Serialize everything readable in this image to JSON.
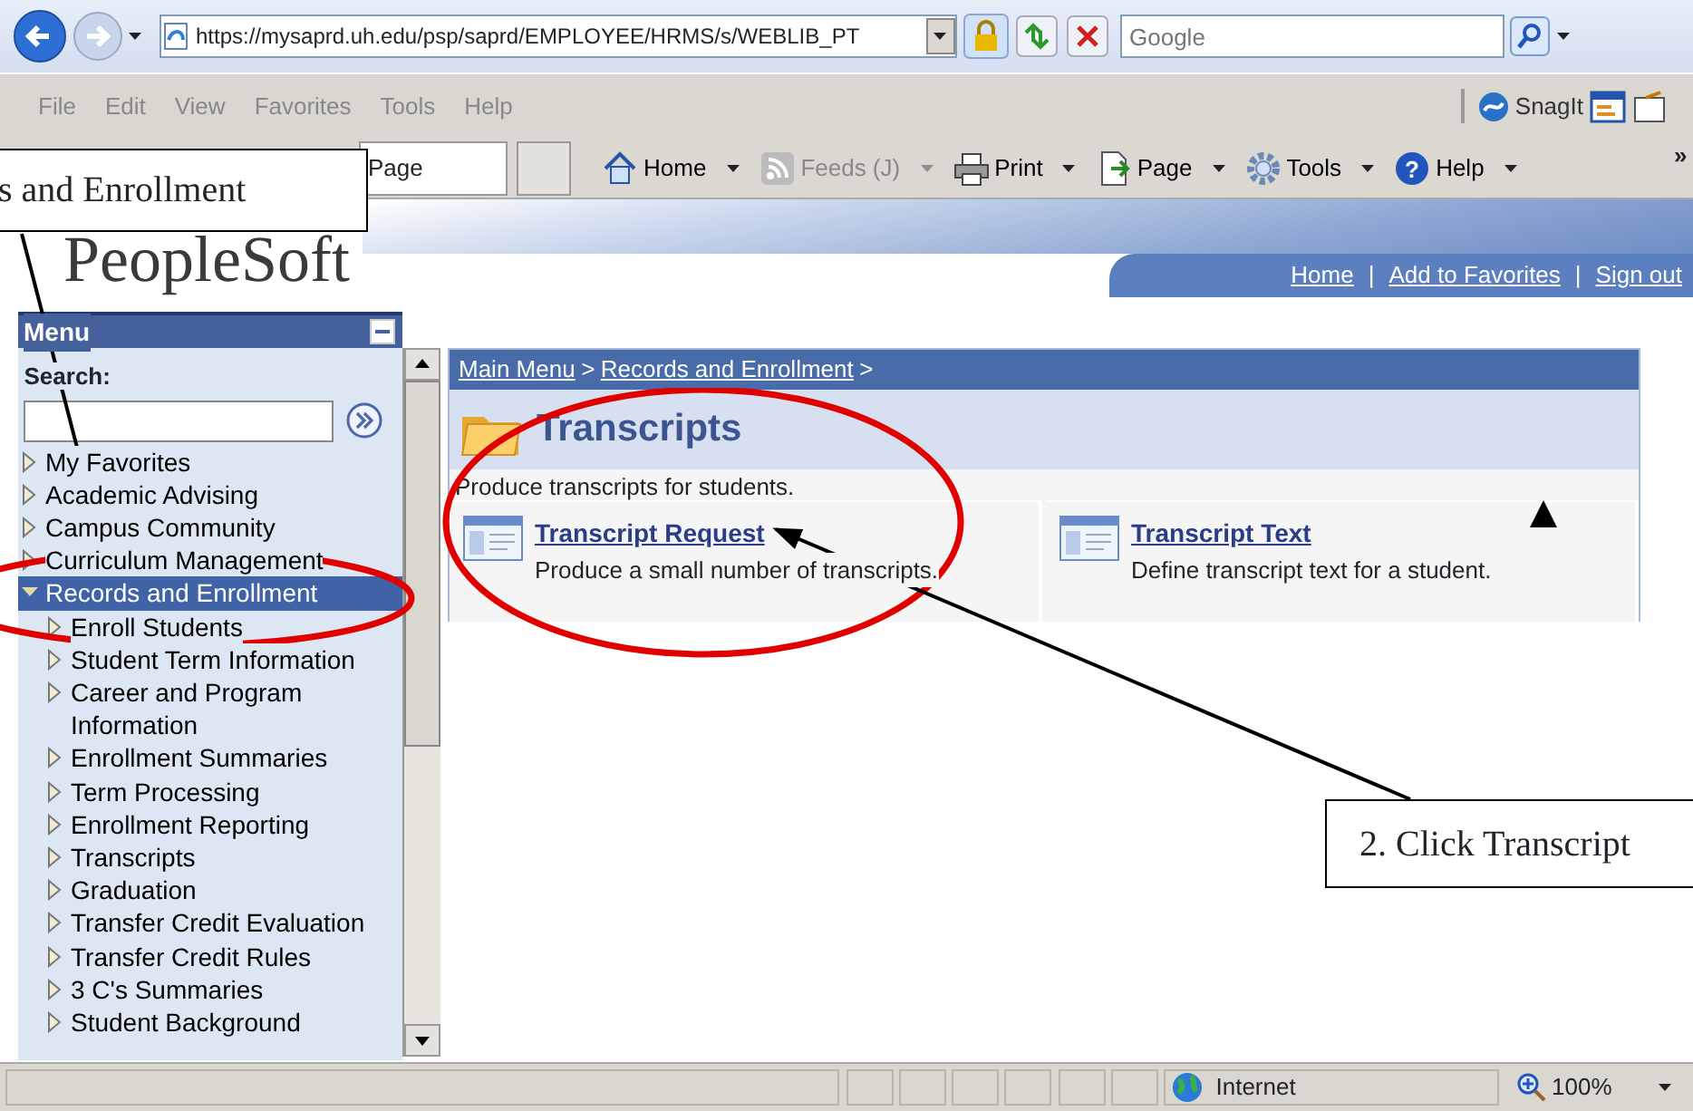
{
  "browser": {
    "address": "https://mysaprd.uh.edu/psp/saprd/EMPLOYEE/HRMS/s/WEBLIB_PT",
    "search_placeholder": "Google",
    "menu": [
      {
        "label": "File",
        "disabled": true
      },
      {
        "label": "Edit",
        "disabled": true
      },
      {
        "label": "View",
        "disabled": true
      },
      {
        "label": "Favorites",
        "disabled": true
      },
      {
        "label": "Tools",
        "disabled": true
      },
      {
        "label": "Help",
        "disabled": true
      }
    ],
    "snagit": "SnagIt"
  },
  "toolbar": {
    "tab": "Page",
    "items": [
      {
        "label": "Home",
        "disabled": false
      },
      {
        "label": "Feeds (J)",
        "disabled": true
      },
      {
        "label": "Print",
        "disabled": false
      },
      {
        "label": "Page",
        "disabled": false
      },
      {
        "label": "Tools",
        "disabled": false
      },
      {
        "label": "Help",
        "disabled": false,
        "glyph": "?"
      }
    ],
    "overflow": "»"
  },
  "header": {
    "logo": "PeopleSoft",
    "links": [
      "Home",
      "Add to Favorites",
      "Sign out"
    ],
    "separator": "|"
  },
  "menu": {
    "title": "Menu",
    "search_label": "Search:",
    "items": [
      {
        "label": "My Favorites",
        "expanded": false,
        "selected": false
      },
      {
        "label": "Academic Advising",
        "expanded": false,
        "selected": false
      },
      {
        "label": "Campus Community",
        "expanded": false,
        "selected": false
      },
      {
        "label": "Curriculum Management",
        "expanded": false,
        "selected": false
      },
      {
        "label": "Records and Enrollment",
        "expanded": true,
        "selected": true,
        "children": [
          {
            "label": "Enroll Students",
            "expanded": false
          },
          {
            "label": "Student Term Information",
            "expanded": false
          },
          {
            "label": "Career and Program Information",
            "expanded": false
          },
          {
            "label": "Enrollment Summaries",
            "expanded": false
          },
          {
            "label": "Term Processing",
            "expanded": false
          },
          {
            "label": "Enrollment Reporting",
            "expanded": false
          },
          {
            "label": "Transcripts",
            "expanded": false
          },
          {
            "label": "Graduation",
            "expanded": false
          },
          {
            "label": "Transfer Credit Evaluation",
            "expanded": false
          },
          {
            "label": "Transfer Credit Rules",
            "expanded": false
          },
          {
            "label": "3 C's Summaries",
            "expanded": false
          },
          {
            "label": "Student Background",
            "expanded": false
          }
        ]
      }
    ]
  },
  "page": {
    "breadcrumb": [
      "Main Menu",
      "Records and Enrollment"
    ],
    "separator": ">",
    "title": "Transcripts",
    "description": "Produce transcripts for students.",
    "items": [
      {
        "title": "Transcript Request",
        "description": "Produce a small number of transcripts."
      },
      {
        "title": "Transcript Text",
        "description": "Define transcript text for a student."
      }
    ]
  },
  "status_bar": {
    "zone": "Internet",
    "zoom": "100%"
  },
  "annotations": [
    {
      "text": "s and Enrollment"
    },
    {
      "text": "2. Click Transcript"
    }
  ]
}
